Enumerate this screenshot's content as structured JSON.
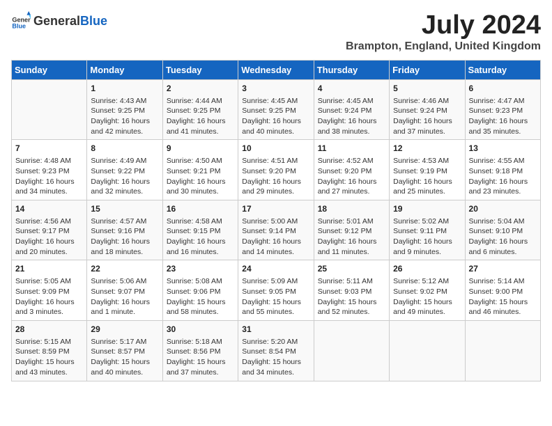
{
  "header": {
    "logo_general": "General",
    "logo_blue": "Blue",
    "month_year": "July 2024",
    "location": "Brampton, England, United Kingdom"
  },
  "weekdays": [
    "Sunday",
    "Monday",
    "Tuesday",
    "Wednesday",
    "Thursday",
    "Friday",
    "Saturday"
  ],
  "weeks": [
    [
      {
        "day": "",
        "info": ""
      },
      {
        "day": "1",
        "info": "Sunrise: 4:43 AM\nSunset: 9:25 PM\nDaylight: 16 hours\nand 42 minutes."
      },
      {
        "day": "2",
        "info": "Sunrise: 4:44 AM\nSunset: 9:25 PM\nDaylight: 16 hours\nand 41 minutes."
      },
      {
        "day": "3",
        "info": "Sunrise: 4:45 AM\nSunset: 9:25 PM\nDaylight: 16 hours\nand 40 minutes."
      },
      {
        "day": "4",
        "info": "Sunrise: 4:45 AM\nSunset: 9:24 PM\nDaylight: 16 hours\nand 38 minutes."
      },
      {
        "day": "5",
        "info": "Sunrise: 4:46 AM\nSunset: 9:24 PM\nDaylight: 16 hours\nand 37 minutes."
      },
      {
        "day": "6",
        "info": "Sunrise: 4:47 AM\nSunset: 9:23 PM\nDaylight: 16 hours\nand 35 minutes."
      }
    ],
    [
      {
        "day": "7",
        "info": "Sunrise: 4:48 AM\nSunset: 9:23 PM\nDaylight: 16 hours\nand 34 minutes."
      },
      {
        "day": "8",
        "info": "Sunrise: 4:49 AM\nSunset: 9:22 PM\nDaylight: 16 hours\nand 32 minutes."
      },
      {
        "day": "9",
        "info": "Sunrise: 4:50 AM\nSunset: 9:21 PM\nDaylight: 16 hours\nand 30 minutes."
      },
      {
        "day": "10",
        "info": "Sunrise: 4:51 AM\nSunset: 9:20 PM\nDaylight: 16 hours\nand 29 minutes."
      },
      {
        "day": "11",
        "info": "Sunrise: 4:52 AM\nSunset: 9:20 PM\nDaylight: 16 hours\nand 27 minutes."
      },
      {
        "day": "12",
        "info": "Sunrise: 4:53 AM\nSunset: 9:19 PM\nDaylight: 16 hours\nand 25 minutes."
      },
      {
        "day": "13",
        "info": "Sunrise: 4:55 AM\nSunset: 9:18 PM\nDaylight: 16 hours\nand 23 minutes."
      }
    ],
    [
      {
        "day": "14",
        "info": "Sunrise: 4:56 AM\nSunset: 9:17 PM\nDaylight: 16 hours\nand 20 minutes."
      },
      {
        "day": "15",
        "info": "Sunrise: 4:57 AM\nSunset: 9:16 PM\nDaylight: 16 hours\nand 18 minutes."
      },
      {
        "day": "16",
        "info": "Sunrise: 4:58 AM\nSunset: 9:15 PM\nDaylight: 16 hours\nand 16 minutes."
      },
      {
        "day": "17",
        "info": "Sunrise: 5:00 AM\nSunset: 9:14 PM\nDaylight: 16 hours\nand 14 minutes."
      },
      {
        "day": "18",
        "info": "Sunrise: 5:01 AM\nSunset: 9:12 PM\nDaylight: 16 hours\nand 11 minutes."
      },
      {
        "day": "19",
        "info": "Sunrise: 5:02 AM\nSunset: 9:11 PM\nDaylight: 16 hours\nand 9 minutes."
      },
      {
        "day": "20",
        "info": "Sunrise: 5:04 AM\nSunset: 9:10 PM\nDaylight: 16 hours\nand 6 minutes."
      }
    ],
    [
      {
        "day": "21",
        "info": "Sunrise: 5:05 AM\nSunset: 9:09 PM\nDaylight: 16 hours\nand 3 minutes."
      },
      {
        "day": "22",
        "info": "Sunrise: 5:06 AM\nSunset: 9:07 PM\nDaylight: 16 hours\nand 1 minute."
      },
      {
        "day": "23",
        "info": "Sunrise: 5:08 AM\nSunset: 9:06 PM\nDaylight: 15 hours\nand 58 minutes."
      },
      {
        "day": "24",
        "info": "Sunrise: 5:09 AM\nSunset: 9:05 PM\nDaylight: 15 hours\nand 55 minutes."
      },
      {
        "day": "25",
        "info": "Sunrise: 5:11 AM\nSunset: 9:03 PM\nDaylight: 15 hours\nand 52 minutes."
      },
      {
        "day": "26",
        "info": "Sunrise: 5:12 AM\nSunset: 9:02 PM\nDaylight: 15 hours\nand 49 minutes."
      },
      {
        "day": "27",
        "info": "Sunrise: 5:14 AM\nSunset: 9:00 PM\nDaylight: 15 hours\nand 46 minutes."
      }
    ],
    [
      {
        "day": "28",
        "info": "Sunrise: 5:15 AM\nSunset: 8:59 PM\nDaylight: 15 hours\nand 43 minutes."
      },
      {
        "day": "29",
        "info": "Sunrise: 5:17 AM\nSunset: 8:57 PM\nDaylight: 15 hours\nand 40 minutes."
      },
      {
        "day": "30",
        "info": "Sunrise: 5:18 AM\nSunset: 8:56 PM\nDaylight: 15 hours\nand 37 minutes."
      },
      {
        "day": "31",
        "info": "Sunrise: 5:20 AM\nSunset: 8:54 PM\nDaylight: 15 hours\nand 34 minutes."
      },
      {
        "day": "",
        "info": ""
      },
      {
        "day": "",
        "info": ""
      },
      {
        "day": "",
        "info": ""
      }
    ]
  ]
}
